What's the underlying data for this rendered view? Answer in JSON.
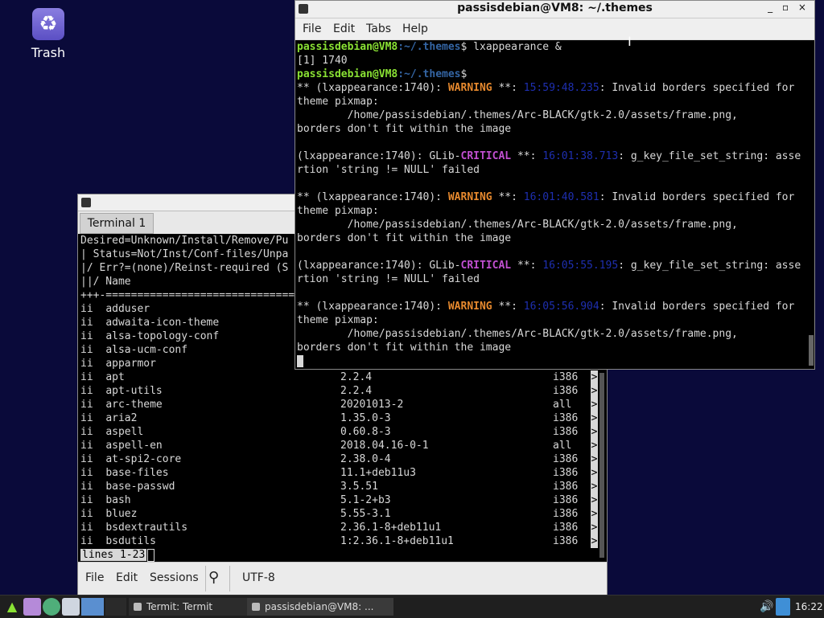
{
  "desktop": {
    "trash_label": "Trash"
  },
  "termit": {
    "tab_label": "Terminal 1",
    "header_lines": [
      "Desired=Unknown/Install/Remove/Pu",
      "| Status=Not/Inst/Conf-files/Unpa",
      "|/ Err?=(none)/Reinst-required (S",
      "||/ Name",
      "+++-=============================="
    ],
    "packages": [
      {
        "st": "ii",
        "name": "adduser",
        "ver": "",
        "arch": ""
      },
      {
        "st": "ii",
        "name": "adwaita-icon-theme",
        "ver": "",
        "arch": ""
      },
      {
        "st": "ii",
        "name": "alsa-topology-conf",
        "ver": "",
        "arch": ""
      },
      {
        "st": "ii",
        "name": "alsa-ucm-conf",
        "ver": "",
        "arch": ""
      },
      {
        "st": "ii",
        "name": "apparmor",
        "ver": "",
        "arch": ""
      },
      {
        "st": "ii",
        "name": "apt",
        "ver": "2.2.4",
        "arch": "i386"
      },
      {
        "st": "ii",
        "name": "apt-utils",
        "ver": "2.2.4",
        "arch": "i386"
      },
      {
        "st": "ii",
        "name": "arc-theme",
        "ver": "20201013-2",
        "arch": "all"
      },
      {
        "st": "ii",
        "name": "aria2",
        "ver": "1.35.0-3",
        "arch": "i386"
      },
      {
        "st": "ii",
        "name": "aspell",
        "ver": "0.60.8-3",
        "arch": "i386"
      },
      {
        "st": "ii",
        "name": "aspell-en",
        "ver": "2018.04.16-0-1",
        "arch": "all"
      },
      {
        "st": "ii",
        "name": "at-spi2-core",
        "ver": "2.38.0-4",
        "arch": "i386"
      },
      {
        "st": "ii",
        "name": "base-files",
        "ver": "11.1+deb11u3",
        "arch": "i386"
      },
      {
        "st": "ii",
        "name": "base-passwd",
        "ver": "3.5.51",
        "arch": "i386"
      },
      {
        "st": "ii",
        "name": "bash",
        "ver": "5.1-2+b3",
        "arch": "i386"
      },
      {
        "st": "ii",
        "name": "bluez",
        "ver": "5.55-3.1",
        "arch": "i386"
      },
      {
        "st": "ii",
        "name": "bsdextrautils",
        "ver": "2.36.1-8+deb11u1",
        "arch": "i386"
      },
      {
        "st": "ii",
        "name": "bsdutils",
        "ver": "1:2.36.1-8+deb11u1",
        "arch": "i386"
      }
    ],
    "more_arrow": ">",
    "status_line": "lines 1-23",
    "menu": {
      "file": "File",
      "edit": "Edit",
      "sessions": "Sessions",
      "encoding": "UTF-8"
    }
  },
  "front": {
    "title": "passisdebian@VM8: ~/.themes",
    "window_buttons": "_ ▫ ×",
    "menu": {
      "file": "File",
      "edit": "Edit",
      "tabs": "Tabs",
      "help": "Help"
    },
    "prompt_user": "passisdebian@VM8",
    "prompt_path": ":~/.themes",
    "command": "$ lxappearance &",
    "job": "[1] 1740",
    "warn_prefix": "** (lxappearance:1740): ",
    "warn_word": "WARNING",
    "warn_sep": " **: ",
    "warn_msg": ": Invalid borders specified for",
    "theme_pixmap": "theme pixmap:",
    "asset_path": "        /home/passisdebian/.themes/Arc-BLACK/gtk-2.0/assets/frame.png,",
    "borders_msg": "borders don't fit within the image",
    "crit_prefix": "(lxappearance:1740): GLib-",
    "crit_word": "CRITICAL",
    "crit_sep": " **: ",
    "crit_msg": ": g_key_file_set_string: asse",
    "crit_msg2": "rtion 'string != NULL' failed",
    "timestamps": [
      "15:59:48.235",
      "16:01:38.713",
      "16:01:40.581",
      "16:05:55.195",
      "16:05:56.904"
    ]
  },
  "taskbar": {
    "task1": "Termit: Termit",
    "task2": "passisdebian@VM8: ...",
    "clock": "16:22"
  }
}
